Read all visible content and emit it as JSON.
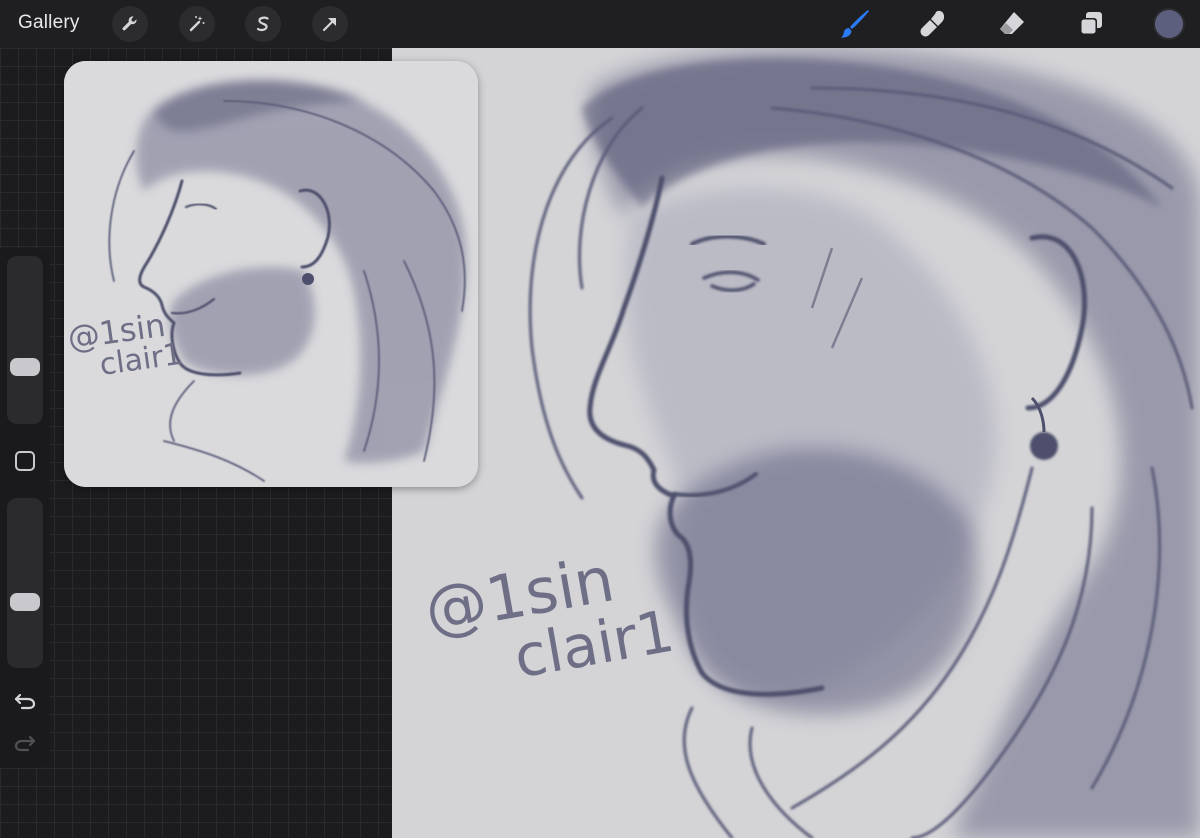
{
  "toolbar": {
    "gallery_label": "Gallery",
    "left_tools": [
      "wrench-icon",
      "magic-wand-icon",
      "selection-icon",
      "transform-arrow-icon"
    ],
    "right_tools": [
      "brush-icon",
      "smudge-icon",
      "eraser-icon",
      "layers-icon"
    ],
    "active_tool": "brush",
    "active_color": "#5c5f7e",
    "accent_color": "#2a7bf6"
  },
  "sidebar": {
    "brush_size": 0.31,
    "opacity": 0.37,
    "controls": [
      "size-slider",
      "modifier-square",
      "opacity-slider",
      "undo-icon",
      "redo-icon"
    ]
  },
  "artwork": {
    "signature_line1": "@1sin",
    "signature_line2": "clair1",
    "ink_color": "#5a5b78",
    "paper_color": "#d4d4d7"
  },
  "reference": {
    "signature_line1": "@1sin",
    "signature_line2": "clair1"
  }
}
